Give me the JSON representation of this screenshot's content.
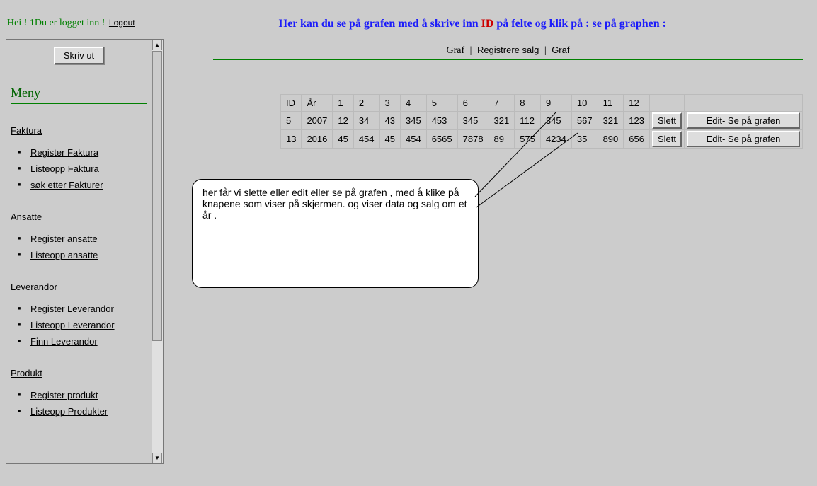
{
  "greeting": {
    "hei": "Hei ! ",
    "one": "1",
    "loggedIn": "Du er logget inn ! "
  },
  "logout": "Logout",
  "headerTitle": {
    "pre": "Her kan du se på grafen med å skrive inn ",
    "id": "ID",
    "post": " på felte og klik på : se på graphen :"
  },
  "subnav": {
    "graf": "Graf",
    "sep1": " | ",
    "reg": "Registrere salg",
    "sep2": " | ",
    "graf2": "Graf"
  },
  "printBtn": "Skriv ut",
  "menyTitle": "Meny",
  "sections": [
    {
      "title": "Faktura",
      "items": [
        "Register Faktura",
        "Listeopp Faktura",
        "søk etter Fakturer"
      ]
    },
    {
      "title": "Ansatte",
      "items": [
        "Register ansatte",
        "Listeopp ansatte"
      ]
    },
    {
      "title": "Leverandor",
      "items": [
        "Register Leverandor",
        "Listeopp Leverandor",
        "Finn Leverandor"
      ]
    },
    {
      "title": "Produkt",
      "items": [
        "Register produkt",
        "Listeopp Produkter"
      ]
    }
  ],
  "table": {
    "headers": [
      "ID",
      "År",
      "1",
      "2",
      "3",
      "4",
      "5",
      "6",
      "7",
      "8",
      "9",
      "10",
      "11",
      "12"
    ],
    "rows": [
      [
        "5",
        "2007",
        "12",
        "34",
        "43",
        "345",
        "453",
        "345",
        "321",
        "112",
        "345",
        "567",
        "321",
        "123"
      ],
      [
        "13",
        "2016",
        "45",
        "454",
        "45",
        "454",
        "6565",
        "7878",
        "89",
        "575",
        "4234",
        "35",
        "890",
        "656"
      ]
    ],
    "slettLabel": "Slett",
    "editLabel": "Edit- Se på grafen"
  },
  "callout": "her får vi slette eller edit  eller se på grafen ,  med å klike på knapene  som viser på skjermen. og viser data og salg om et år ."
}
